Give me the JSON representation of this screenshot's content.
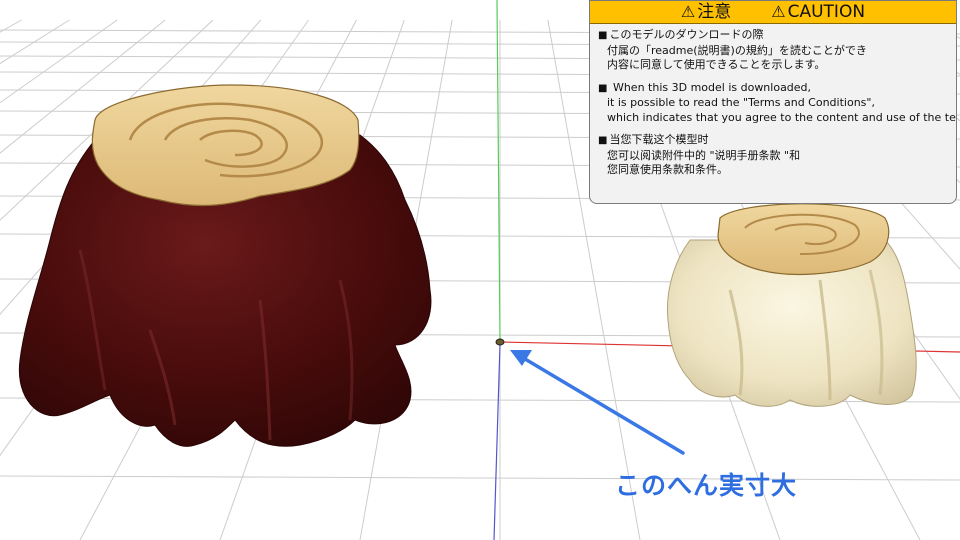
{
  "notice": {
    "header_left": "注意",
    "header_right": "CAUTION",
    "jp_line1": "このモデルのダウンロードの際",
    "jp_line2": "付属の「readme(説明書)の規約」を読むことができ",
    "jp_line3": "内容に同意して使用できることを示します。",
    "en_line1": "When this 3D model is downloaded,",
    "en_line2": "it is possible to read the \"Terms and Conditions\",",
    "en_line3": "which indicates that you agree to the content and use of the text.",
    "zh_line1": "当您下载这个模型时",
    "zh_line2": "您可以阅读附件中的 \"说明手册条款 \"和",
    "zh_line3": "您同意使用条款和条件。"
  },
  "annotation": {
    "label": "このへん実寸大"
  },
  "colors": {
    "notice_header": "#ffc000",
    "notice_background": "#f2f2f2",
    "annotation_blue": "#2f6ee0",
    "dark_stump": "#4a0c0c",
    "light_stump": "#efe7c8",
    "stump_top": "#e8c98a",
    "axis_red": "#d33",
    "axis_green": "#3c3",
    "axis_blue": "#33c"
  },
  "icons": [
    "warning-icon",
    "bullet-square",
    "origin-marker",
    "arrow"
  ]
}
